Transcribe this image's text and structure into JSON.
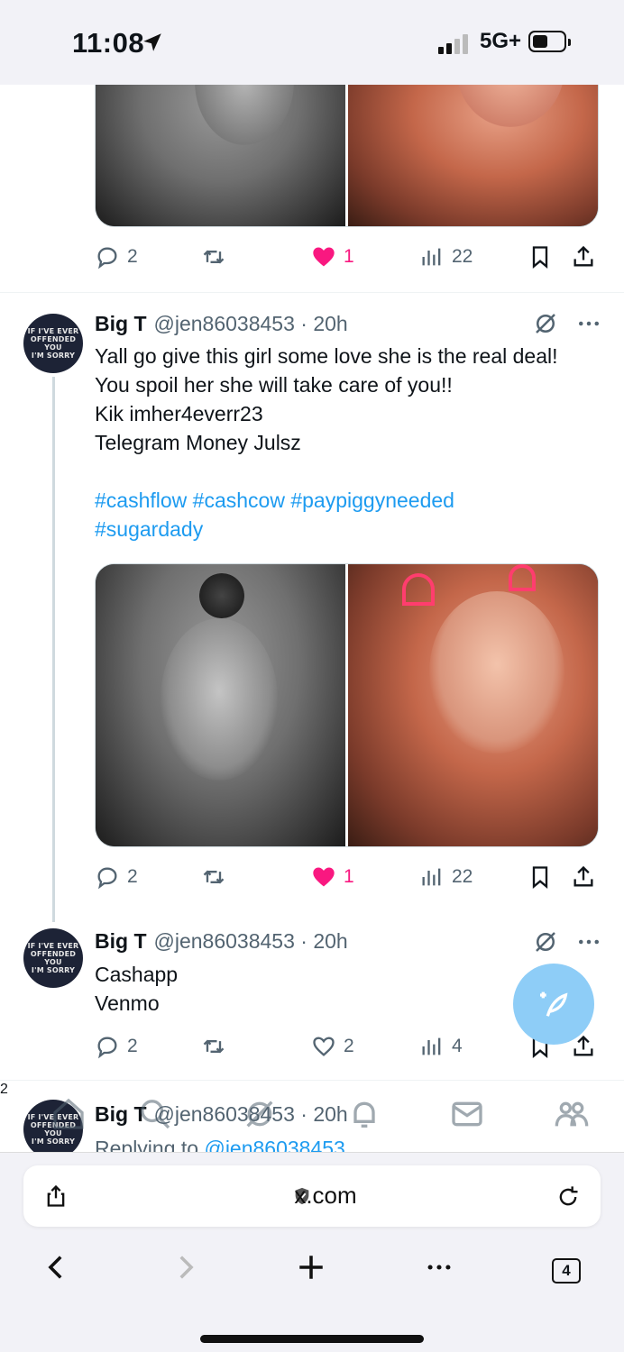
{
  "status_bar": {
    "time": "11:08",
    "network": "5G+"
  },
  "tweets": [
    {
      "id": "prev",
      "stats": {
        "replies": "2",
        "reposts": "",
        "likes": "1",
        "views": "22"
      }
    },
    {
      "id": "main",
      "name": "Big T",
      "handle": "@jen86038453 · 20h",
      "body_lines": [
        "Yall go give this girl some love she is the real deal!",
        "You spoil her she will take care of you!!",
        "Kik imher4everr23",
        "Telegram Money Julsz"
      ],
      "hashtags_lines": [
        "#cashflow #cashcow #paypiggyneeded",
        "#sugardady"
      ],
      "stats": {
        "replies": "2",
        "reposts": "",
        "likes": "1",
        "views": "22"
      }
    },
    {
      "id": "reply",
      "name": "Big T",
      "handle": "@jen86038453 · 20h",
      "body_lines": [
        "Cashapp",
        "Venmo"
      ],
      "stats": {
        "replies": "2",
        "reposts": "",
        "likes": "2",
        "views": "4"
      }
    },
    {
      "id": "next",
      "name": "Big T",
      "handle": "@jen86038453 · 20h",
      "replying_prefix": "Replying to ",
      "replying_to": "@jen86038453"
    }
  ],
  "avatar_text": [
    "IF I'VE EVER",
    "OFFENDED YOU",
    "I'M SORRY"
  ],
  "nav": {
    "notifications_badge": "2"
  },
  "browser": {
    "domain": "x.com",
    "tab_count": "4"
  },
  "colors": {
    "accent": "#1d9bf0",
    "like": "#f91880",
    "muted": "#536471"
  }
}
